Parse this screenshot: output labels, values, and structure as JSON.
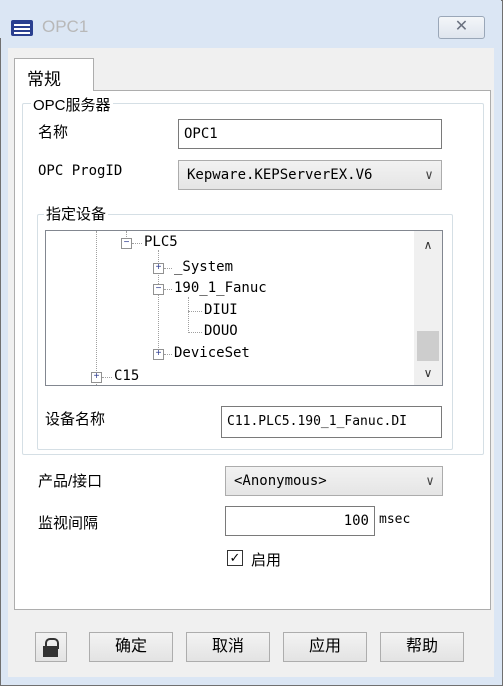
{
  "window": {
    "title": "OPC1",
    "close_glyph": "✕"
  },
  "tabs": [
    {
      "label": "常规"
    }
  ],
  "opc_group": {
    "title": "OPC服务器",
    "name_label": "名称",
    "name_value": "OPC1",
    "progid_label": "OPC ProgID",
    "progid_value": "Kepware.KEPServerEX.V6"
  },
  "device_group": {
    "title": "指定设备",
    "tree": {
      "plc5": "PLC5",
      "system": "_System",
      "fanuc": "190_1_Fanuc",
      "diui": "DIUI",
      "douo": "DOUO",
      "deviceset": "DeviceSet",
      "c15": "C15"
    },
    "device_name_label": "设备名称",
    "device_name_value": "C11.PLC5.190_1_Fanuc.DI"
  },
  "product_label": "产品/接口",
  "product_value": "<Anonymous>",
  "monitor_label": "监视间隔",
  "monitor_value": "100",
  "monitor_unit": "msec",
  "enable_label": "启用",
  "enable_checked": true,
  "buttons": {
    "ok": "确定",
    "cancel": "取消",
    "apply": "应用",
    "help": "帮助"
  },
  "icons": {
    "app": "app-icon",
    "lock": "lock-icon",
    "close": "close-icon"
  }
}
